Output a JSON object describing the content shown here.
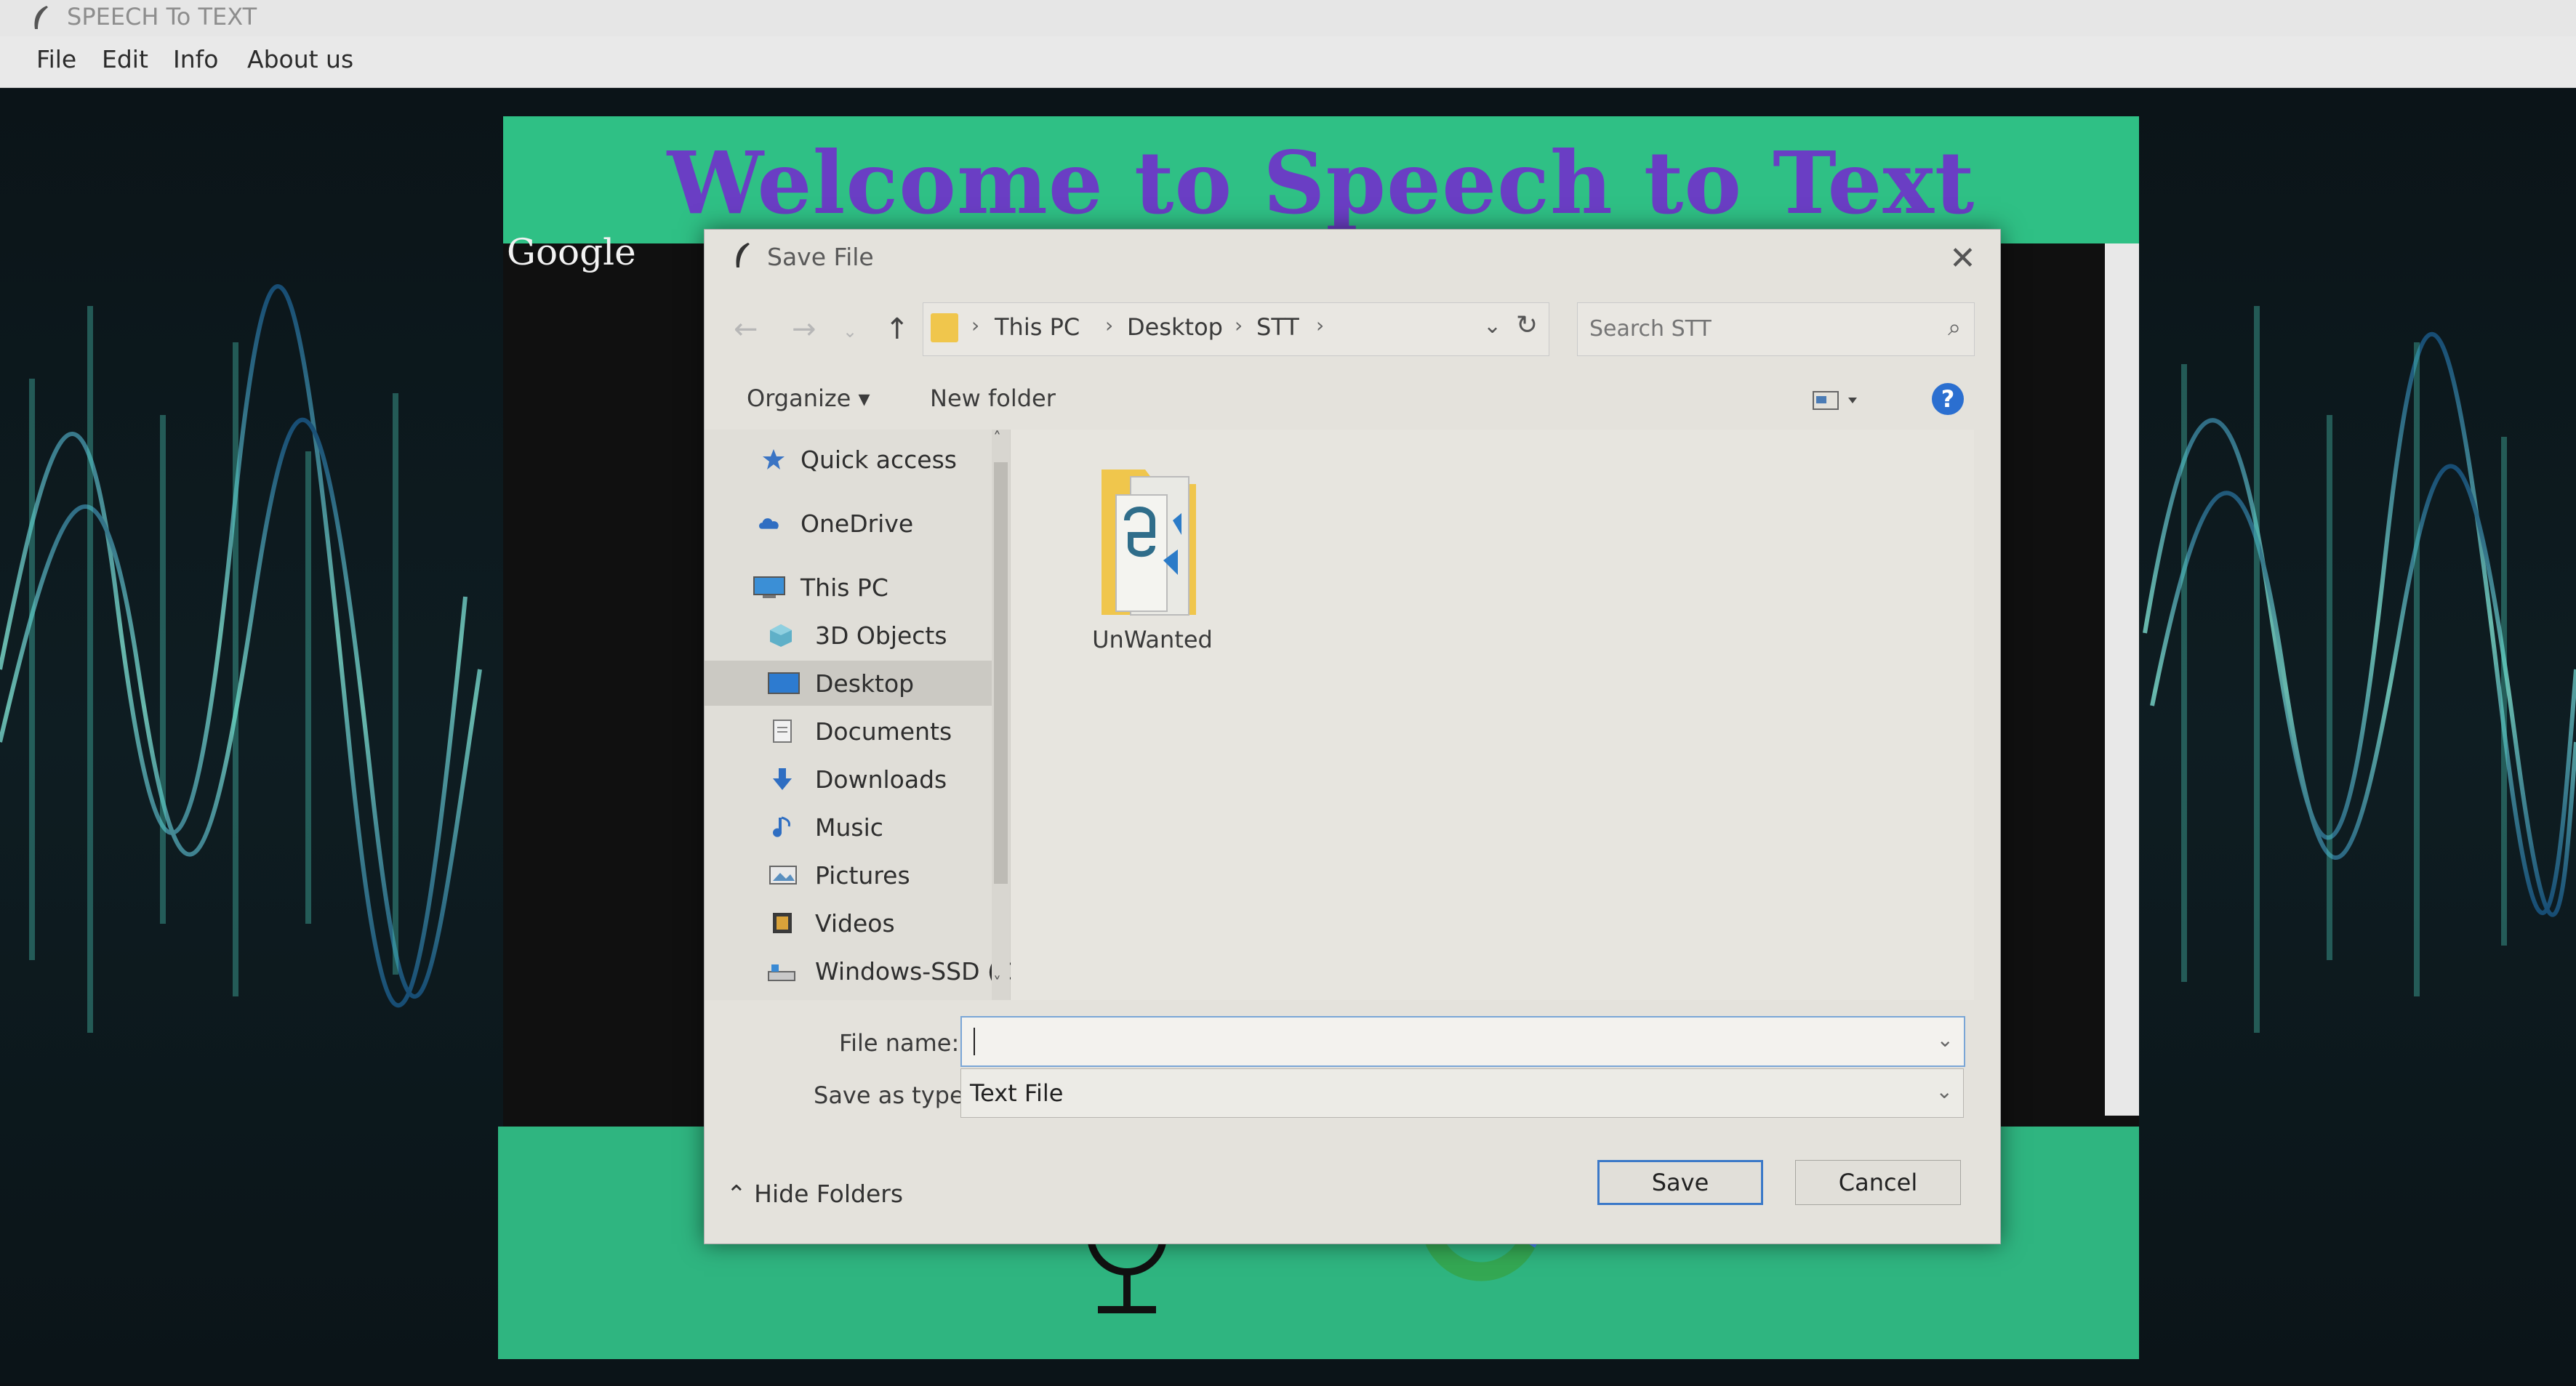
{
  "app": {
    "title": "SPEECH To TEXT",
    "menu": [
      "File",
      "Edit",
      "Info",
      "About us"
    ],
    "welcome": "Welcome to Speech to Text",
    "google_label": "Google",
    "banner_color": "#2fc085",
    "welcome_color": "#6a3ec4"
  },
  "dialog": {
    "title": "Save File",
    "close_glyph": "✕",
    "breadcrumb": [
      "This PC",
      "Desktop",
      "STT"
    ],
    "search_placeholder": "Search STT",
    "toolbar": {
      "organize": "Organize ▾",
      "new_folder": "New folder",
      "help": "?"
    },
    "nav_items": [
      {
        "label": "Quick access",
        "icon": "star-icon"
      },
      {
        "label": "OneDrive",
        "icon": "cloud-icon"
      },
      {
        "label": "This PC",
        "icon": "computer-icon"
      },
      {
        "label": "3D Objects",
        "icon": "cube-icon"
      },
      {
        "label": "Desktop",
        "icon": "desktop-icon",
        "selected": true
      },
      {
        "label": "Documents",
        "icon": "document-icon"
      },
      {
        "label": "Downloads",
        "icon": "download-arrow-icon"
      },
      {
        "label": "Music",
        "icon": "music-note-icon"
      },
      {
        "label": "Pictures",
        "icon": "picture-icon"
      },
      {
        "label": "Videos",
        "icon": "film-icon"
      },
      {
        "label": "Windows-SSD (C",
        "icon": "drive-icon"
      }
    ],
    "files": [
      {
        "name": "UnWanted",
        "icon": "folder-icon"
      }
    ],
    "file_name_label": "File name:",
    "file_name_value": "",
    "save_type_label": "Save as type:",
    "save_type_value": "Text File",
    "hide_folders": "Hide Folders",
    "save_label": "Save",
    "cancel_label": "Cancel",
    "accent_color": "#3b79c8"
  }
}
